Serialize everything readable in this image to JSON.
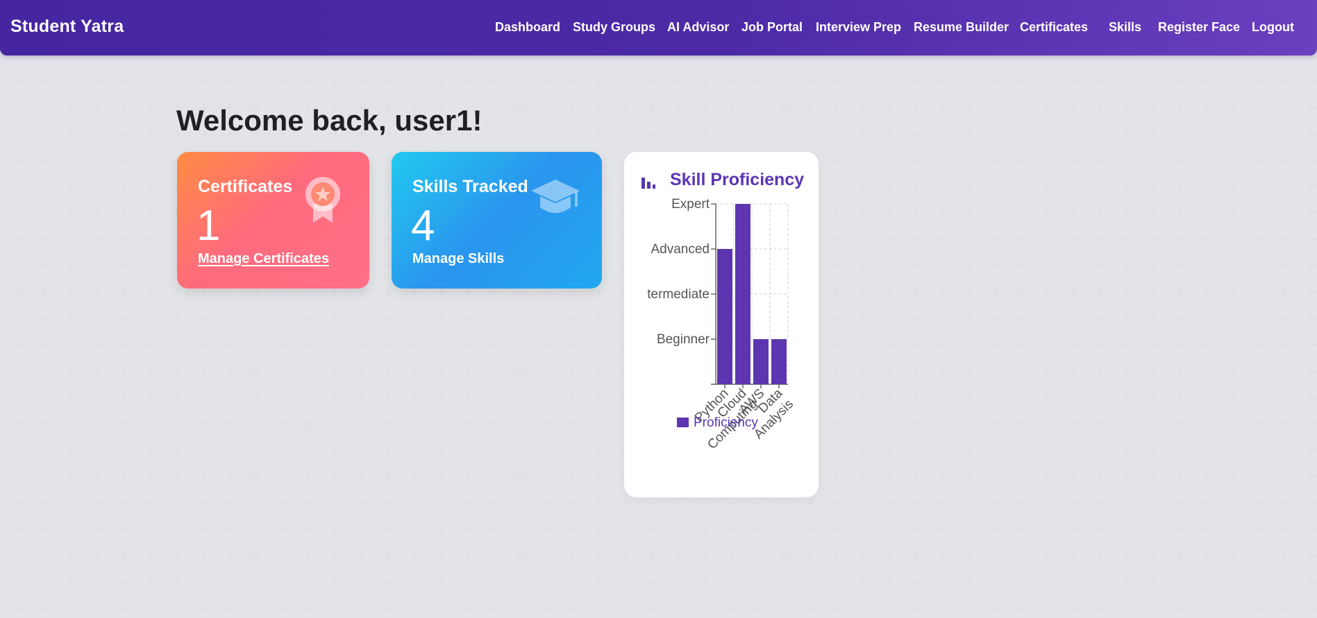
{
  "navbar": {
    "brand": "Student Yatra",
    "links": [
      {
        "id": "dashboard",
        "label": "Dashboard"
      },
      {
        "id": "study-groups",
        "label": "Study Groups"
      },
      {
        "id": "ai-advisor",
        "label": "AI Advisor"
      },
      {
        "id": "job-portal",
        "label": "Job Portal"
      },
      {
        "id": "interview-prep",
        "label": "Interview Prep"
      },
      {
        "id": "resume-builder",
        "label": "Resume Builder"
      },
      {
        "id": "certificates",
        "label": "Certificates"
      },
      {
        "id": "skills",
        "label": "Skills"
      },
      {
        "id": "register-face",
        "label": "Register Face"
      },
      {
        "id": "logout",
        "label": "Logout"
      }
    ]
  },
  "main": {
    "welcome": "Welcome back, user1!",
    "cards": {
      "certificates": {
        "title": "Certificates",
        "value": "1",
        "link": "Manage Certificates",
        "icon": "award-icon"
      },
      "skills": {
        "title": "Skills Tracked",
        "value": "4",
        "link": "Manage Skills",
        "icon": "graduation-cap-icon"
      }
    }
  },
  "chart_card": {
    "title": "Skill Proficiency",
    "icon": "bar-chart-icon"
  },
  "chart_data": {
    "type": "bar",
    "categories": [
      "Python",
      "Cloud Computing",
      "AWS",
      "Data Analysis"
    ],
    "category_labels": [
      [
        "Python"
      ],
      [
        "Cloud",
        "Computing"
      ],
      [
        "AWS"
      ],
      [
        "Data",
        "Analysis"
      ]
    ],
    "series": [
      {
        "name": "Proficiency",
        "values": [
          3,
          4,
          1,
          1
        ]
      }
    ],
    "y_tick_labels": [
      "Beginner",
      "Intermediate",
      "Advanced",
      "Expert"
    ],
    "y_tick_display": [
      "Beginner",
      "termediate",
      "Advanced",
      "Expert"
    ],
    "ylim": [
      0,
      4
    ],
    "grid": true,
    "legend": "bottom",
    "color": "#5d35b1"
  },
  "colors": {
    "navbar_start": "#4526a0",
    "navbar_end": "#6a3fc0",
    "accent": "#5b36b3",
    "cert_card": "#ff6f86",
    "skill_card": "#2a95ee"
  }
}
